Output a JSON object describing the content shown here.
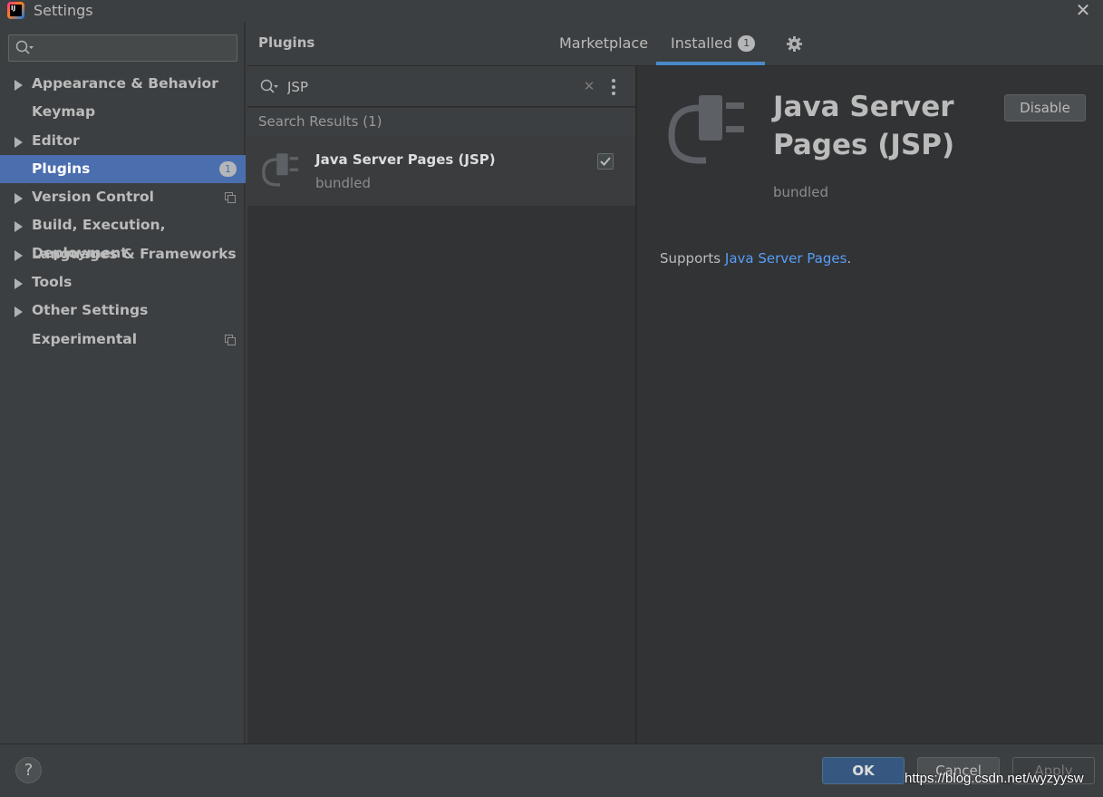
{
  "window": {
    "title": "Settings",
    "logo_text": "IJ"
  },
  "sidebar": {
    "search_value": "",
    "items": [
      {
        "label": "Appearance & Behavior",
        "expandable": true,
        "selected": false
      },
      {
        "label": "Keymap",
        "expandable": false,
        "selected": false
      },
      {
        "label": "Editor",
        "expandable": true,
        "selected": false
      },
      {
        "label": "Plugins",
        "expandable": false,
        "selected": true,
        "badge": "1"
      },
      {
        "label": "Version Control",
        "expandable": true,
        "selected": false,
        "project_icon": true
      },
      {
        "label": "Build, Execution, Deployment",
        "expandable": true,
        "selected": false
      },
      {
        "label": "Languages & Frameworks",
        "expandable": true,
        "selected": false
      },
      {
        "label": "Tools",
        "expandable": true,
        "selected": false
      },
      {
        "label": "Other Settings",
        "expandable": true,
        "selected": false
      },
      {
        "label": "Experimental",
        "expandable": false,
        "selected": false,
        "project_icon": true
      }
    ]
  },
  "plugins": {
    "title": "Plugins",
    "tabs": [
      {
        "label": "Marketplace",
        "active": false
      },
      {
        "label": "Installed",
        "active": true,
        "badge": "1"
      }
    ],
    "search_value": "JSP",
    "results_header": "Search Results (1)",
    "results": [
      {
        "name": "Java Server Pages (JSP)",
        "sub": "bundled",
        "enabled": true
      }
    ]
  },
  "detail": {
    "name": "Java Server Pages (JSP)",
    "sub": "bundled",
    "disable_label": "Disable",
    "desc_prefix": "Supports ",
    "desc_link": "Java Server Pages",
    "desc_suffix": "."
  },
  "footer": {
    "help_label": "?",
    "ok_label": "OK",
    "cancel_label": "Cancel",
    "apply_label": "Apply",
    "watermark": "https://blog.csdn.net/wyzyysw"
  },
  "colors": {
    "selection": "#4b6eaf",
    "tab_underline": "#4a88c7",
    "link": "#589df6",
    "ok_button": "#365880"
  }
}
